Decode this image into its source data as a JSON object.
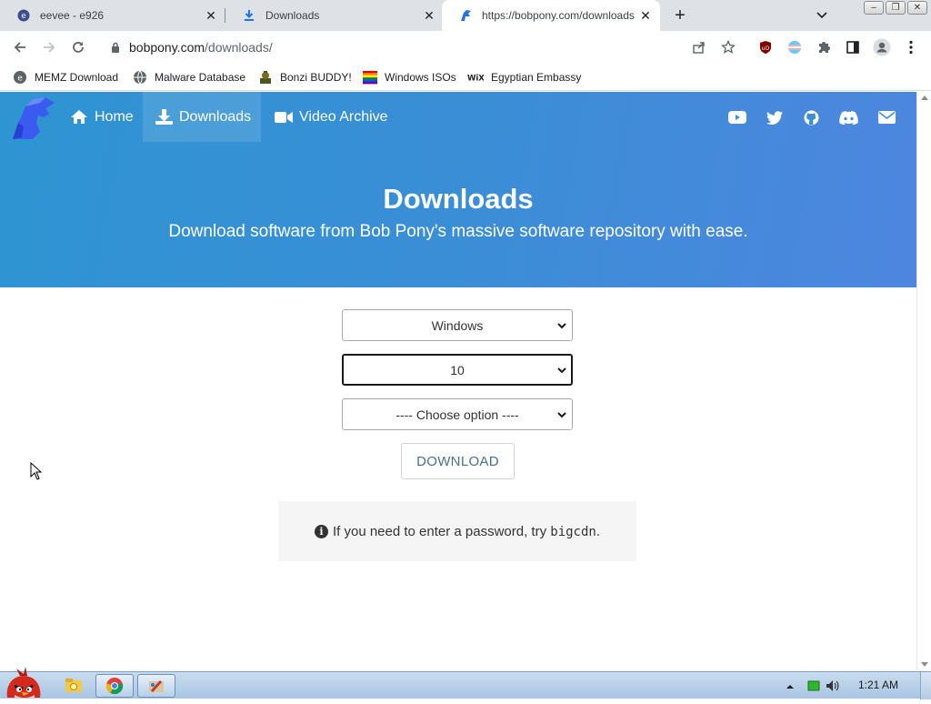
{
  "browser": {
    "tabs": [
      {
        "title": "eevee - e926",
        "icon": "e926-favicon"
      },
      {
        "title": "Downloads",
        "icon": "download-arrow-favicon"
      },
      {
        "title": "https://bobpony.com/downloads",
        "icon": "bobpony-favicon",
        "active": true
      }
    ],
    "address": {
      "host": "bobpony.com",
      "path": "/downloads/"
    },
    "bookmarks": [
      {
        "label": "MEMZ Download",
        "icon": "memz-icon"
      },
      {
        "label": "Malware Database",
        "icon": "globe-icon"
      },
      {
        "label": "Bonzi BUDDY!",
        "icon": "bonzi-icon"
      },
      {
        "label": "Windows ISOs",
        "icon": "windows-flag-icon"
      },
      {
        "label": "Egyptian Embassy",
        "icon": "wix-icon"
      }
    ]
  },
  "site": {
    "nav": [
      {
        "label": "Home",
        "icon": "home-icon"
      },
      {
        "label": "Downloads",
        "icon": "download-icon",
        "active": true
      },
      {
        "label": "Video Archive",
        "icon": "video-camera-icon"
      }
    ],
    "social": [
      "youtube-icon",
      "twitter-icon",
      "github-icon",
      "discord-icon",
      "email-icon"
    ],
    "hero": {
      "title": "Downloads",
      "subtitle": "Download software from Bob Pony's massive software repository with ease."
    },
    "form": {
      "os_select": "Windows",
      "version_select": "10",
      "option_select": "---- Choose option ----",
      "download_label": "DOWNLOAD"
    },
    "note": {
      "text_before": "If you need to enter a password, try ",
      "password": "bigcdn",
      "text_after": "."
    }
  },
  "taskbar": {
    "apps": [
      "explorer-icon",
      "chrome-icon",
      "paint-icon"
    ],
    "clock": "1:21 AM"
  },
  "colors": {
    "hero_start": "#2e94d2",
    "hero_end": "#4e86df",
    "tabstrip": "#dee1e6"
  }
}
